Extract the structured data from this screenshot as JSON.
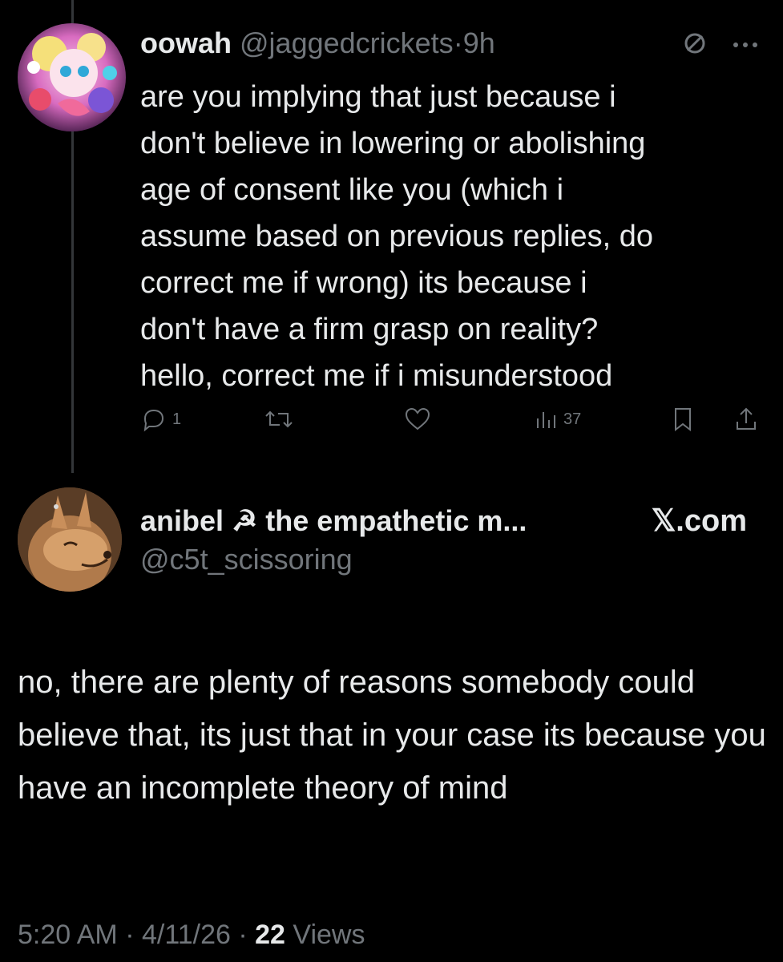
{
  "reply": {
    "author_name": "oowah",
    "author_handle": "@jaggedcrickets",
    "separator": "·",
    "time": "9h",
    "more_label": "···",
    "body": "are you implying that just because i\ndon't believe in lowering or abolishing\nage of consent like you (which i\nassume based on previous replies, do\ncorrect me if wrong)  its because i\ndon't have a firm grasp on reality?\nhello, correct me if i misunderstood",
    "actions": {
      "reply_count": "1",
      "views_count": "37"
    },
    "icons": [
      "no-sign-icon",
      "more-icon",
      "reply-icon",
      "retweet-icon",
      "like-icon",
      "views-icon",
      "bookmark-icon",
      "share-icon"
    ]
  },
  "main_post": {
    "author_name": "anibel ☭ the empathetic m...",
    "author_handle": "@c5t_scissoring",
    "source_label": "𝕏.com",
    "body": "no, there are plenty of reasons somebody could believe that, its just that in your case its because you have an incomplete theory of mind",
    "meta": {
      "time": "5:20 AM",
      "sep1": " · ",
      "date": "4/11/26",
      "sep2": " · ",
      "views_count": "22",
      "views_label": " Views"
    }
  },
  "colors": {
    "background": "#000000",
    "text_primary": "#e7e9ea",
    "text_secondary": "#71767b",
    "thread_line": "#333639"
  }
}
